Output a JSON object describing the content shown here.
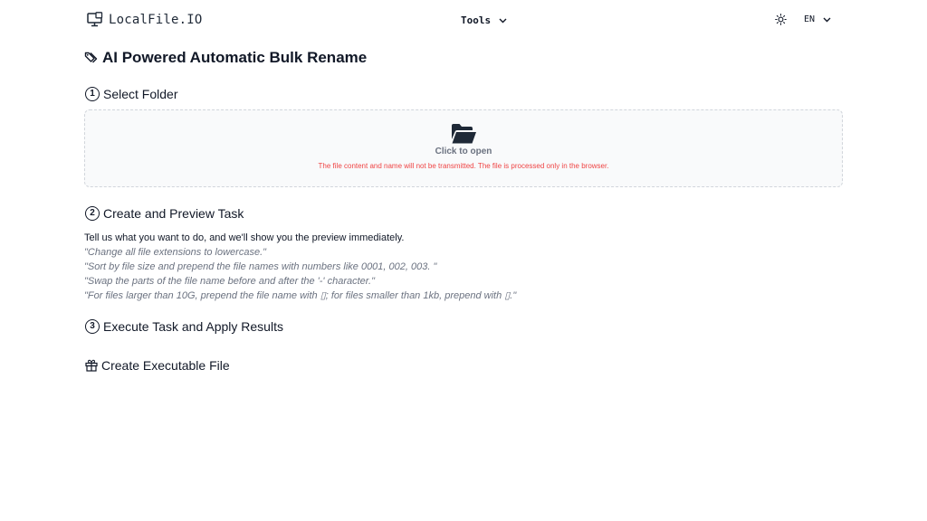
{
  "header": {
    "logo_text": "LocalFile.IO",
    "tools_label": "Tools",
    "language": "EN"
  },
  "page": {
    "title": "AI Powered Automatic Bulk Rename"
  },
  "steps": [
    {
      "number": "1",
      "title": "Select Folder"
    },
    {
      "number": "2",
      "title": "Create and Preview Task"
    },
    {
      "number": "3",
      "title": "Execute Task and Apply Results"
    }
  ],
  "dropzone": {
    "label": "Click to open",
    "notice": "The file content and name will not be transmitted. The file is processed only in the browser."
  },
  "task": {
    "intro": "Tell us what you want to do, and we'll show you the preview immediately.",
    "examples": [
      "\"Change all file extensions to lowercase.\"",
      "\"Sort by file size and prepend the file names with numbers like 0001, 002, 003. \"",
      "\"Swap the parts of the file name before and after the '-' character.\"",
      "\"For files larger than 10G, prepend the file name with ▯; for files smaller than 1kb, prepend with ▯.\""
    ]
  },
  "create_file": {
    "title": "Create Executable File"
  },
  "colors": {
    "text": "#111827",
    "muted": "#6b7280",
    "notice": "#ef4444",
    "dropzone_bg": "#f9fafb",
    "dropzone_border": "#d1d5db"
  }
}
